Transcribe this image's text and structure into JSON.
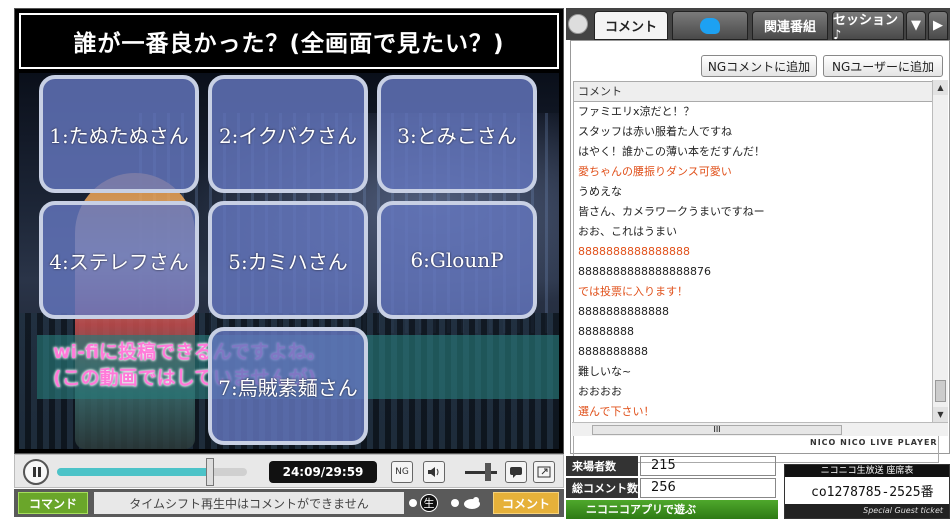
{
  "player": {
    "question": "誰が一番良かった？(全画面で見たい？)",
    "options": [
      "1:たぬたぬさん",
      "2:イクバクさん",
      "3:とみこさん",
      "4:ステレフさん",
      "5:カミハさん",
      "6:GlounP",
      "7:烏賊素麺さん"
    ],
    "subtitle": "wi-fiに投稿できるんですよね。\n(この動画ではしていませんが)",
    "time": "24:09/29:59",
    "progress": 0.805,
    "ng_icon_label": "NG",
    "volume_level": 0.75
  },
  "command_bar": {
    "command_label": "コマンド",
    "message": "タイムシフト再生中はコメントができません",
    "live_badge": "生",
    "comment_label": "コメント"
  },
  "tabs": {
    "comment": "コメント",
    "related": "関連番組",
    "session": "セッション♪"
  },
  "comments": {
    "ng_comment_button": "NGコメントに追加",
    "ng_user_button": "NGユーザーに追加",
    "column_header": "コメント",
    "rows": [
      {
        "text": "ファミエリx涼だと！？",
        "color": "#222222"
      },
      {
        "text": "スタッフは赤い服着た人ですね",
        "color": "#222222"
      },
      {
        "text": "はやく！誰かこの薄い本をだすんだ！",
        "color": "#222222"
      },
      {
        "text": "愛ちゃんの腰振りダンス可愛い",
        "color": "#e0501a"
      },
      {
        "text": "うめえな",
        "color": "#222222"
      },
      {
        "text": "皆さん、カメラワークうまいですねー",
        "color": "#222222"
      },
      {
        "text": "おお、これはうまい",
        "color": "#222222"
      },
      {
        "text": "8888888888888888",
        "color": "#e0501a"
      },
      {
        "text": "8888888888888888876",
        "color": "#222222"
      },
      {
        "text": "では投票に入ります！",
        "color": "#e0501a"
      },
      {
        "text": "8888888888888",
        "color": "#222222"
      },
      {
        "text": "88888888",
        "color": "#222222"
      },
      {
        "text": "8888888888",
        "color": "#222222"
      },
      {
        "text": "難しいな~",
        "color": "#222222"
      },
      {
        "text": "おおおお",
        "color": "#222222"
      },
      {
        "text": "選んで下さい！",
        "color": "#e0501a"
      }
    ],
    "hscroll_label": "III",
    "brand": "NICO NICO LIVE PLAYER"
  },
  "stats": {
    "visitors_label": "来場者数",
    "visitors_value": "215",
    "comments_label": "総コメント数",
    "comments_value": "256",
    "app_button": "ニコニコアプリで遊ぶ"
  },
  "ticket": {
    "header": "ニコニコ生放送 座席表",
    "code": "co1278785-2525番",
    "footer": "Special Guest ticket"
  }
}
